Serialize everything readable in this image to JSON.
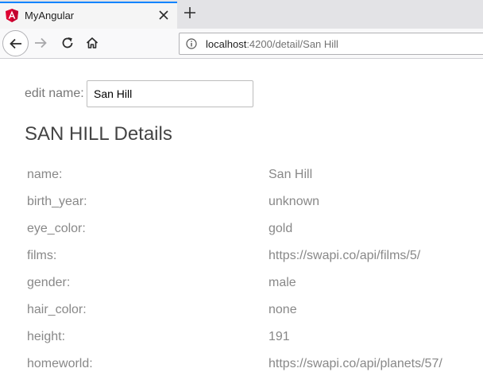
{
  "browser": {
    "tab": {
      "title": "MyAngular"
    },
    "address_bar": {
      "host": "localhost",
      "path": ":4200/detail/San Hill"
    }
  },
  "page": {
    "edit_label": "edit name:",
    "edit_value": "San Hill",
    "heading": "SAN HILL Details",
    "details": [
      {
        "key": "name:",
        "value": "San Hill"
      },
      {
        "key": "birth_year:",
        "value": "unknown"
      },
      {
        "key": "eye_color:",
        "value": "gold"
      },
      {
        "key": "films:",
        "value": "https://swapi.co/api/films/5/"
      },
      {
        "key": "gender:",
        "value": "male"
      },
      {
        "key": "hair_color:",
        "value": "none"
      },
      {
        "key": "height:",
        "value": "191"
      },
      {
        "key": "homeworld:",
        "value": "https://swapi.co/api/planets/57/"
      }
    ]
  },
  "colors": {
    "tab_accent": "#0a84ff",
    "angular_red": "#dd0031",
    "label_gray": "#888888",
    "heading_gray": "#444444"
  },
  "icons": [
    "angular-icon",
    "close-icon",
    "plus-icon",
    "back-arrow-icon",
    "forward-arrow-icon",
    "reload-icon",
    "home-icon",
    "info-icon"
  ]
}
